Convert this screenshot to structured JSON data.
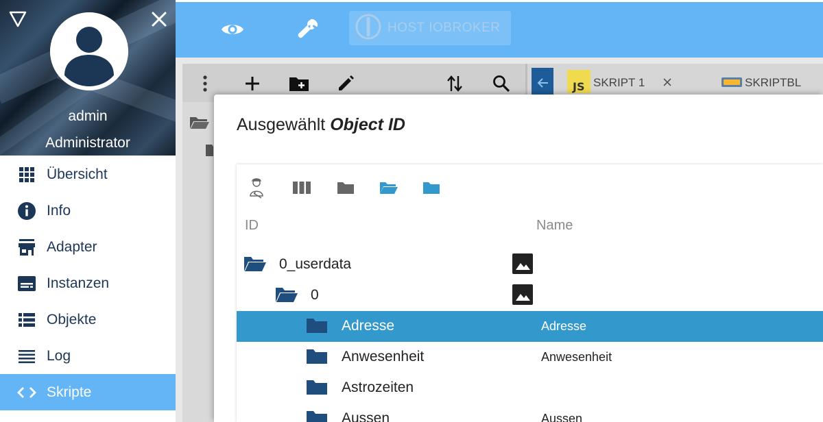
{
  "sidebar": {
    "user": {
      "name": "admin",
      "role": "Administrator"
    },
    "items": [
      {
        "label": "Übersicht",
        "icon": "apps-icon"
      },
      {
        "label": "Info",
        "icon": "info-icon"
      },
      {
        "label": "Adapter",
        "icon": "store-icon"
      },
      {
        "label": "Instanzen",
        "icon": "instances-icon"
      },
      {
        "label": "Objekte",
        "icon": "list-icon"
      },
      {
        "label": "Log",
        "icon": "log-icon"
      },
      {
        "label": "Skripte",
        "icon": "code-icon",
        "active": true
      }
    ]
  },
  "topbar": {
    "host_label": "HOST IOBROKER",
    "color": "#64b5f6"
  },
  "scripts": {
    "tabs": [
      {
        "badge": "JS",
        "label": "SKRIPT 1"
      },
      {
        "badge": "blockly",
        "label": "SKRIPTBL"
      }
    ]
  },
  "dialog": {
    "title_prefix": "Ausgewählt",
    "title_emphasis": "Object ID",
    "columns": {
      "id": "ID",
      "name": "Name"
    },
    "rows": [
      {
        "id": "0_userdata",
        "name": "",
        "level": 0,
        "open": true,
        "has_image": true
      },
      {
        "id": "0",
        "name": "",
        "level": 1,
        "open": true,
        "has_image": true
      },
      {
        "id": "Adresse",
        "name": "Adresse",
        "level": 2,
        "open": false,
        "selected": true
      },
      {
        "id": "Anwesenheit",
        "name": "Anwesenheit",
        "level": 2,
        "open": false
      },
      {
        "id": "Astrozeiten",
        "name": "",
        "level": 2,
        "open": false
      },
      {
        "id": "Aussen",
        "name": "Aussen",
        "level": 2,
        "open": false
      }
    ]
  },
  "colors": {
    "accent": "#64b5f6",
    "selected_row": "#3399cc",
    "icon_dark": "#1c3756",
    "folder": "#1e4d7e"
  }
}
